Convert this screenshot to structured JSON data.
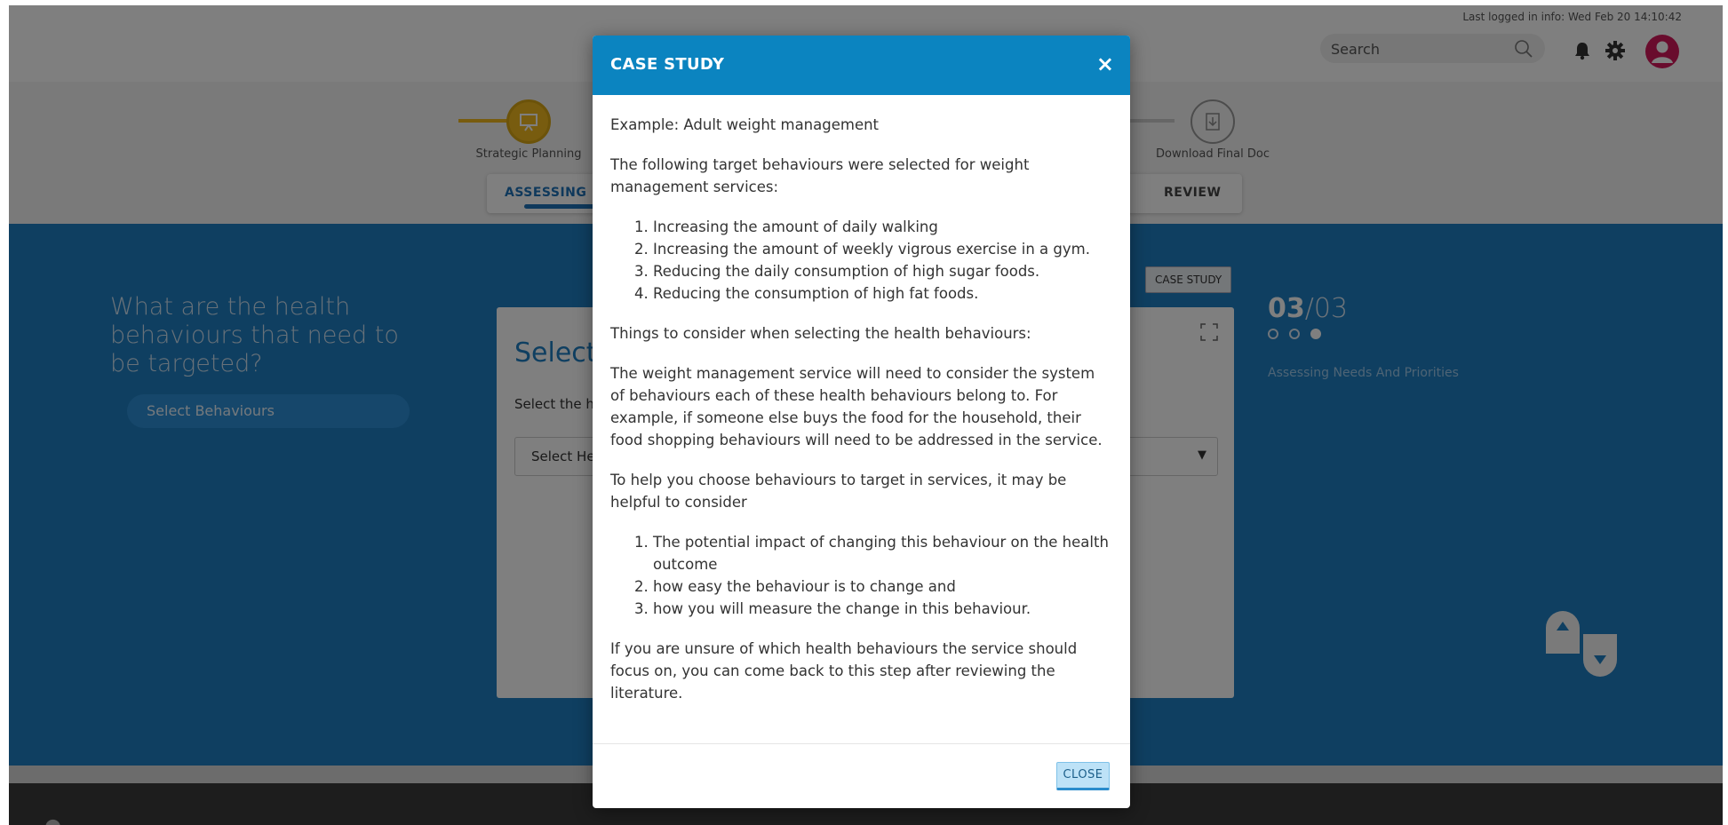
{
  "header": {
    "last_login": "Last logged in info: Wed Feb 20 14:10:42",
    "search_placeholder": "Search"
  },
  "steps": [
    {
      "label": "Strategic Planning",
      "state": "active"
    },
    {
      "label": "Download Final Doc",
      "state": "inactive"
    }
  ],
  "subtabs": [
    "ASSESSING NE",
    "REVIEW"
  ],
  "main": {
    "question": "What are the health behaviours that need to be targeted?",
    "select_pill": "Select Behaviours",
    "case_study_button": "CASE STUDY",
    "card_title": "Select",
    "card_subtitle": "Select the he",
    "card_select_text": "Select He",
    "counter_current": "03",
    "counter_total": "/03",
    "section_label": "Assessing Needs And Priorities"
  },
  "modal": {
    "title": "CASE STUDY",
    "close_x": "×",
    "example": "Example: Adult weight management",
    "intro": "The following target behaviours were selected for weight management services:",
    "behaviours": [
      "Increasing the amount of daily walking",
      "Increasing the amount of weekly vigrous exercise in a gym.",
      "Reducing the daily consumption of high sugar foods.",
      "Reducing the consumption of high fat foods."
    ],
    "consider_heading": "Things to consider when selecting the health behaviours:",
    "system_paragraph": "The weight management service will need to consider the system of behaviours each of these health behaviours belong to. For example, if someone else buys the food for the household, their food shopping behaviours will need to be addressed in the service.",
    "help_paragraph": "To help you choose behaviours to target in services, it may be helpful to consider",
    "considerations": [
      "The potential impact of changing this behaviour on the health outcome",
      "how easy the behaviour is to change and",
      "how you will measure the change in this behaviour."
    ],
    "closing_paragraph": "If you are unsure of which health behaviours the service should focus on, you can come back to this step after reviewing the literature.",
    "close_button": "CLOSE"
  },
  "colors": {
    "modal_header": "#0b84c0",
    "content_blue": "#1f7ec2",
    "step_active": "#f0b81e",
    "avatar": "#d3185a"
  }
}
